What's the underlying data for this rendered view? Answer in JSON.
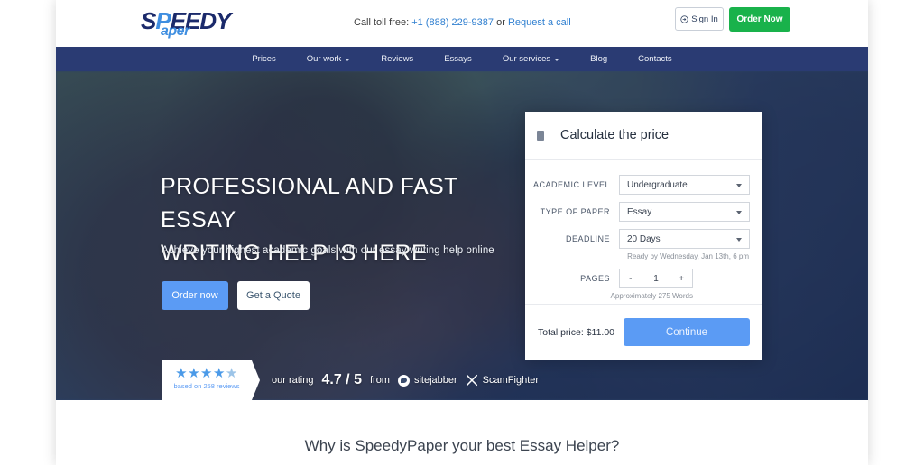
{
  "brand": {
    "logo_line1_a": "S",
    "logo_line1_b": "P",
    "logo_line1_c": "EEDY",
    "logo_line2": "aper"
  },
  "topbar": {
    "call_label": "Call toll free:",
    "phone": "+1 (888) 229-9387",
    "or": "or",
    "request_call": "Request a call",
    "sign_in": "Sign In",
    "order_now": "Order Now",
    "sign_in_icon": "login-arrow-icon"
  },
  "nav": {
    "items": [
      {
        "label": "Prices",
        "has_caret": false
      },
      {
        "label": "Our work",
        "has_caret": true
      },
      {
        "label": "Reviews",
        "has_caret": false
      },
      {
        "label": "Essays",
        "has_caret": false
      },
      {
        "label": "Our services",
        "has_caret": true
      },
      {
        "label": "Blog",
        "has_caret": false
      },
      {
        "label": "Contacts",
        "has_caret": false
      }
    ]
  },
  "hero": {
    "title_line1": "PROFESSIONAL AND FAST ESSAY",
    "title_line2": "WRITING HELP IS HERE",
    "subtitle": "Achieve your highest academic goals with our essay writing help online",
    "btn_order": "Order now",
    "btn_quote": "Get a Quote"
  },
  "calculator": {
    "title": "Calculate the price",
    "title_icon": "document-icon",
    "fields": [
      {
        "label": "ACADEMIC LEVEL",
        "value": "Undergraduate"
      },
      {
        "label": "TYPE OF PAPER",
        "value": "Essay"
      },
      {
        "label": "DEADLINE",
        "value": "20 Days"
      }
    ],
    "deadline_hint": "Ready by Wednesday, Jan 13th, 6 pm",
    "pages_label": "PAGES",
    "pages_minus": "-",
    "pages_value": "1",
    "pages_plus": "+",
    "pages_hint": "Approximately 275 Words",
    "total_price": "Total price: $11.00",
    "continue": "Continue"
  },
  "rating": {
    "stars_filled": "★★★★",
    "stars_half": "★",
    "reviews_note": "based on 258 reviews",
    "our_rating": "our rating",
    "score": "4.7 / 5",
    "from": "from",
    "sitejabber": "sitejabber",
    "scamfighter": "ScamFighter",
    "sitejabber_icon": "speech-bubble-icon",
    "scamfighter_icon": "crossed-swords-icon"
  },
  "bottom": {
    "heading": "Why is SpeedyPaper your best Essay Helper?"
  },
  "colors": {
    "nav_bg": "#2a3b73",
    "green": "#19b24b",
    "blue": "#5b9bf4",
    "link": "#2f7fd0"
  }
}
